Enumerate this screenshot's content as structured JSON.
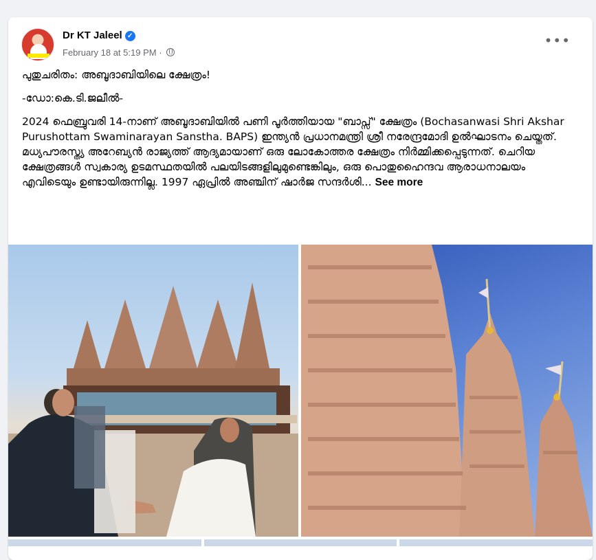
{
  "post": {
    "author": "Dr KT Jaleel",
    "date": "February 18 at 5:19 PM",
    "separator": "·",
    "more_label": "•••",
    "paragraphs": [
      "പുതുചരിതം: അബൂദാബിയിലെ  ക്ഷേത്രം!",
      "-ഡോ:കെ.ടി.ജലീൽ-",
      "2024 ഫെബ്രുവരി 14-നാണ് അബൂദാബിയിൽ പണി പൂർത്തിയായ \"ബാപ്സ്\" ക്ഷേത്രം (Bochasanwasi Shri Akshar Purushottam Swaminarayan Sanstha. BAPS) ഇന്ത്യൻ പ്രധാനമന്ത്രി ശ്രീ നരേന്ദ്രമോദി ഉൽഘാടനം ചെയ്തത്.  മധ്യപൗരസ്ത്യ അറേബ്യൻ രാജ്യത്ത് ആദ്യമായാണ് ഒരു ലോകോത്തര ക്ഷേത്രം നിർമ്മിക്കപ്പെടുന്നത്. ചെറിയ ക്ഷേത്രങ്ങൾ സ്വകാര്യ ഉടമസ്ഥതയിൽ പലയിടങ്ങളിലുമുണ്ടെങ്കിലും, ഒരു പൊതുഹൈന്ദവ ആരാധനാലയം എവിടെയും ഉണ്ടായിരുന്നില്ല. 1997 ഏപ്രിൽ അഞ്ചിന് ഷാർജ സന്ദർശി..."
    ],
    "see_more": "See more"
  },
  "colors": {
    "accent": "#1877f2",
    "secondary_text": "#65676b",
    "page_bg": "#f0f2f5"
  },
  "icons": {
    "verified": "verified-badge-icon",
    "privacy": "globe-icon",
    "menu": "more-options-icon"
  }
}
